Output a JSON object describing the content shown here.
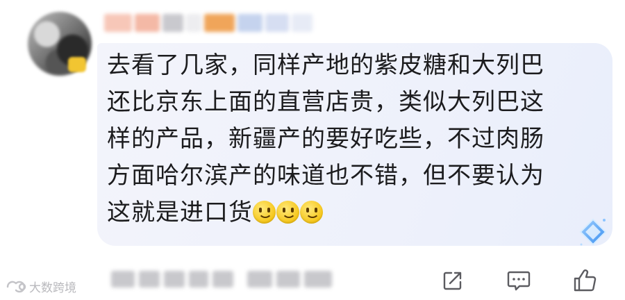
{
  "comment": {
    "username": "",
    "text_lines": [
      "去看了几家，同样产地的紫皮糖和大列巴",
      "还比京东上面的直营店贵，类似大列巴这",
      "样的产品，新疆产的要好吃些，不过肉肠",
      "方面哈尔滨产的味道也不错，但不要认为",
      "这就是进口货"
    ],
    "emoji_count": 3,
    "emoji_icon": "slightly-smiling-face-icon"
  },
  "actions": {
    "share_icon": "share-icon",
    "reply_icon": "comment-icon",
    "like_icon": "thumbs-up-icon"
  },
  "watermark": {
    "text": "大数跨境"
  },
  "colors": {
    "bubble": "#eef1fb",
    "text": "#1c1c1e",
    "icon": "#5b5b60",
    "diamond": "#5aa8f5"
  }
}
